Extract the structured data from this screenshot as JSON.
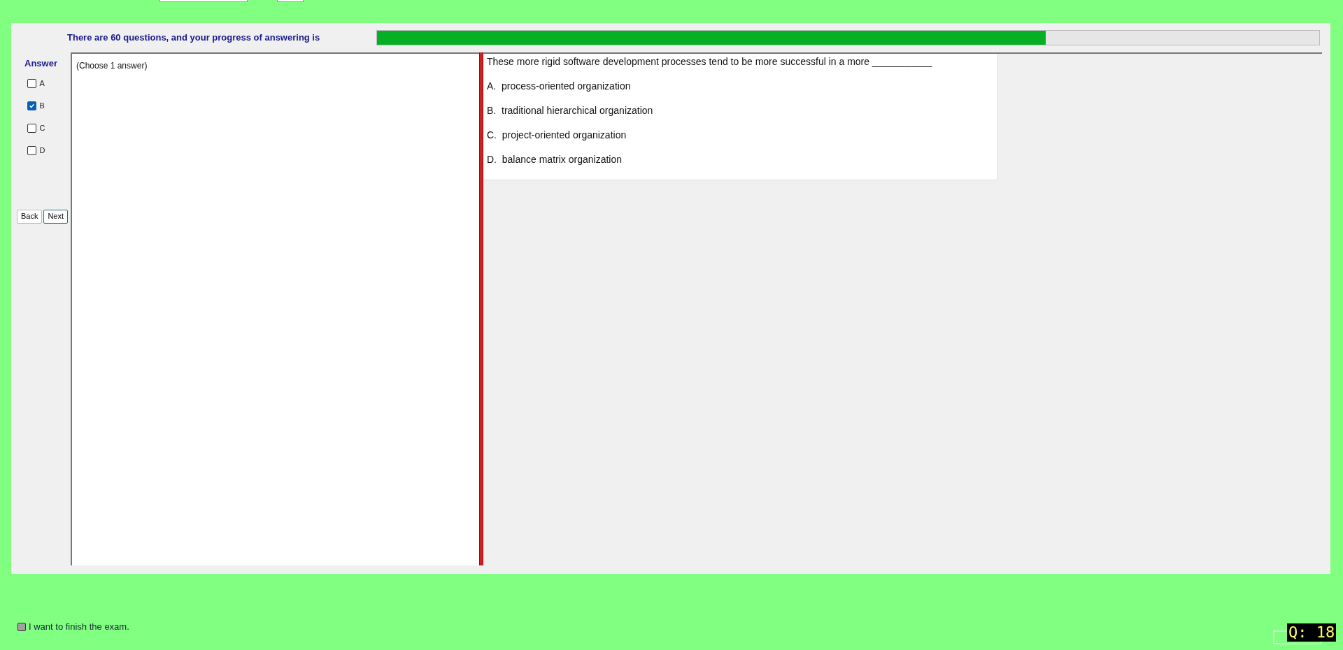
{
  "progress": {
    "label": "There are 60 questions, and your progress of answering is",
    "level": 0.71
  },
  "answer_panel": {
    "title": "Answer",
    "options": [
      {
        "label": "A",
        "checked": false
      },
      {
        "label": "B",
        "checked": true
      },
      {
        "label": "C",
        "checked": false
      },
      {
        "label": "D",
        "checked": false
      }
    ],
    "buttons": [
      "Back",
      "Next"
    ]
  },
  "answer_note": "(Choose 1 answer)",
  "question": {
    "text": "These more rigid software development processes tend to be more successful in a more ___________",
    "choices": [
      {
        "letter": "A.",
        "text": "process-oriented organization"
      },
      {
        "letter": "B.",
        "text": "traditional hierarchical organization"
      },
      {
        "letter": "C.",
        "text": "project-oriented organization"
      },
      {
        "letter": "D.",
        "text": "balance matrix organization"
      }
    ]
  },
  "finish": {
    "label": "I want to finish the exam.",
    "checked": false
  },
  "question_counter": "Q: 18"
}
